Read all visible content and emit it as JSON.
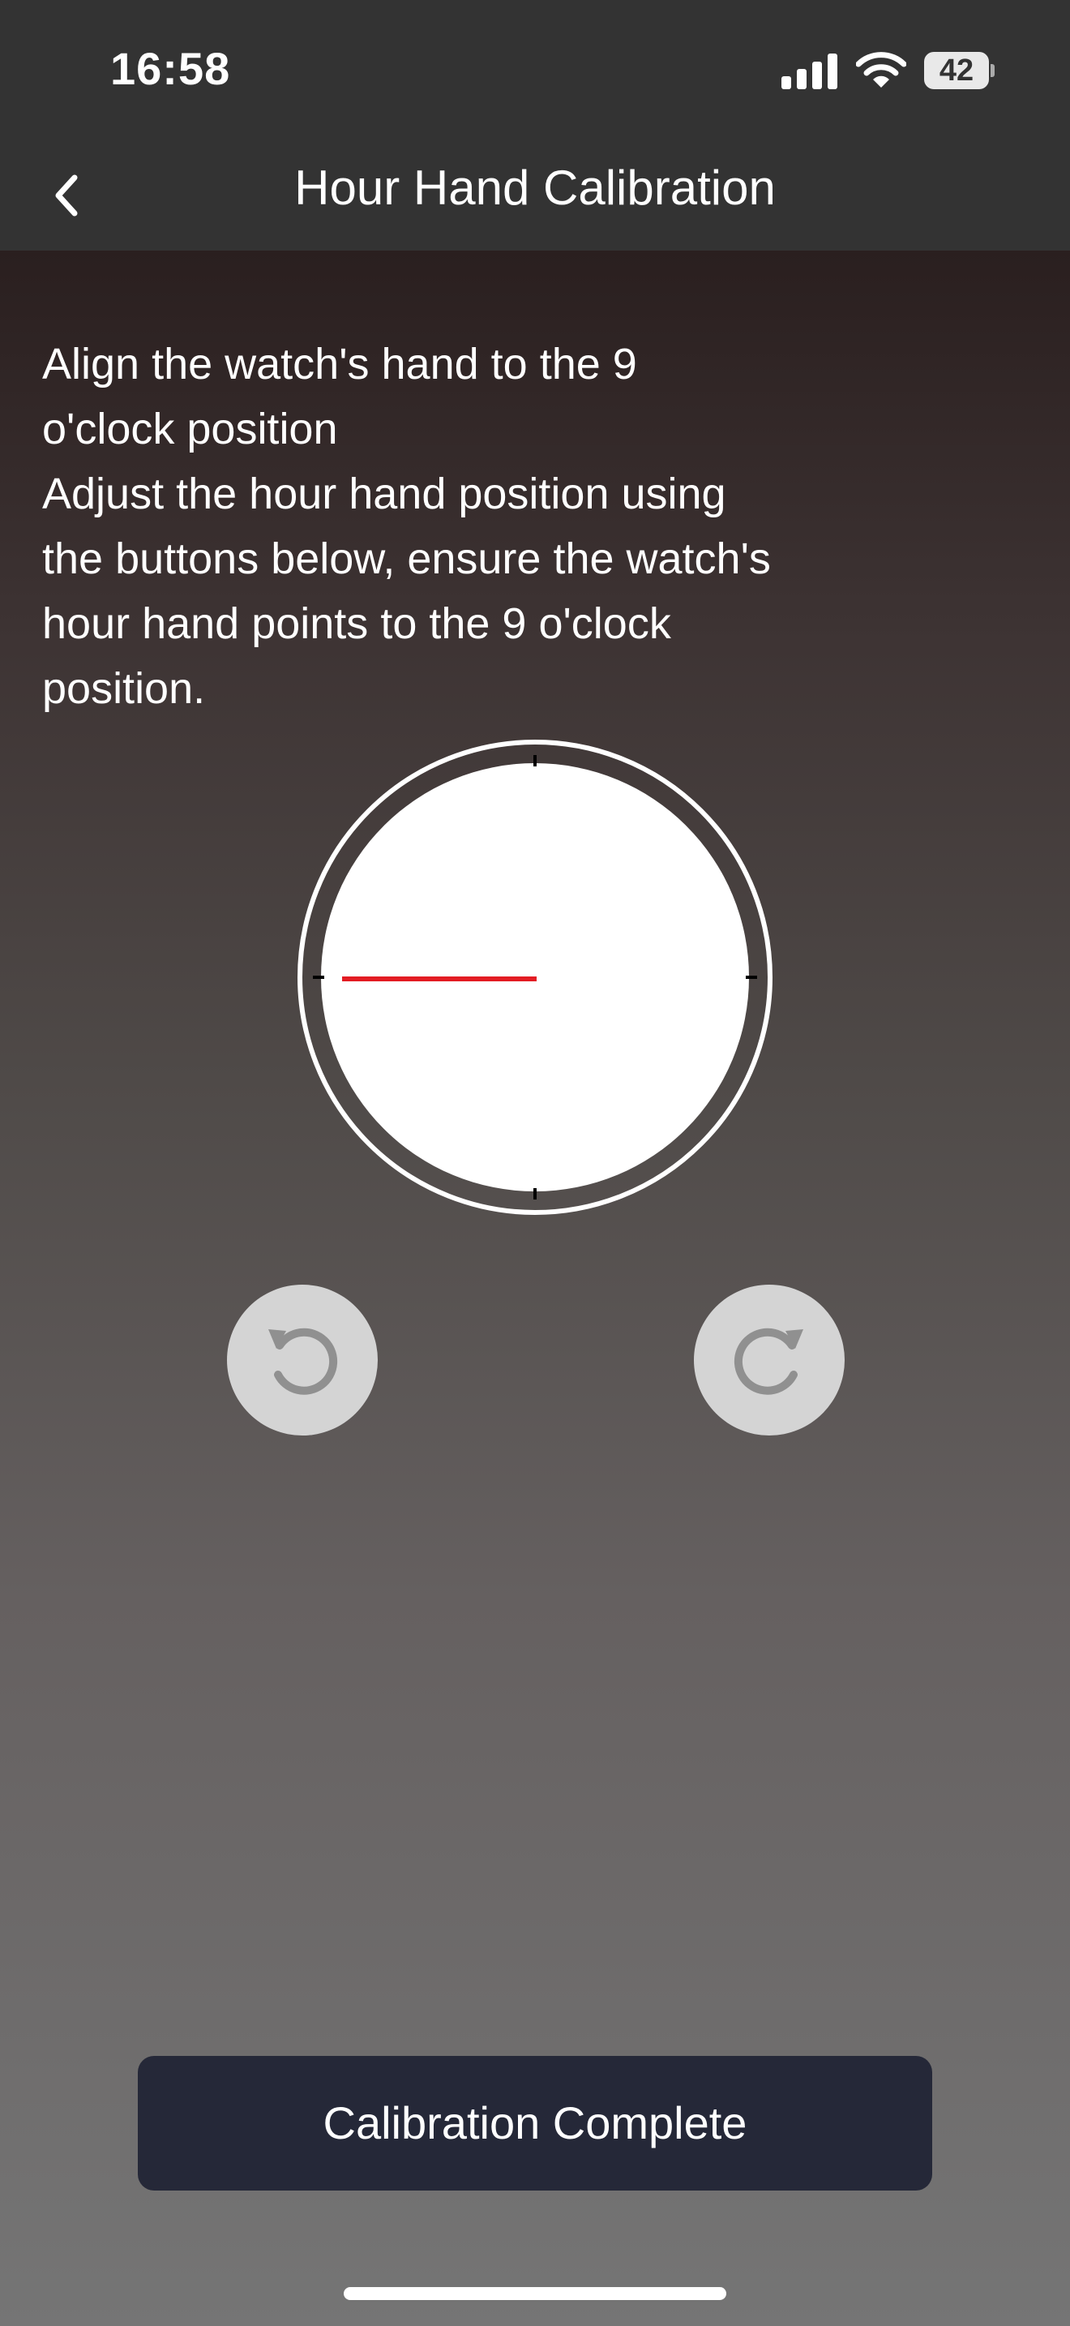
{
  "status_bar": {
    "time": "16:58",
    "battery_level": "42",
    "icons": [
      "signal-icon",
      "wifi-icon",
      "battery-icon"
    ]
  },
  "nav": {
    "back_icon": "chevron-left-icon",
    "title": "Hour Hand Calibration"
  },
  "instruction": {
    "text": "Align the watch's hand to the 9\no'clock position\nAdjust the hour hand position using\nthe buttons below, ensure the watch's\nhour hand points to the 9 o'clock\nposition."
  },
  "dial": {
    "hand_position_oclock": 9,
    "hand_color": "#e31c23"
  },
  "controls": {
    "rotate_counterclockwise_icon": "rotate-ccw-icon",
    "rotate_clockwise_icon": "rotate-cw-icon"
  },
  "footer": {
    "complete_label": "Calibration Complete"
  },
  "colors": {
    "bar_background": "#333333",
    "button_background": "#252838",
    "rotate_button_background": "#d4d4d4",
    "rotate_icon_color": "#909090"
  }
}
